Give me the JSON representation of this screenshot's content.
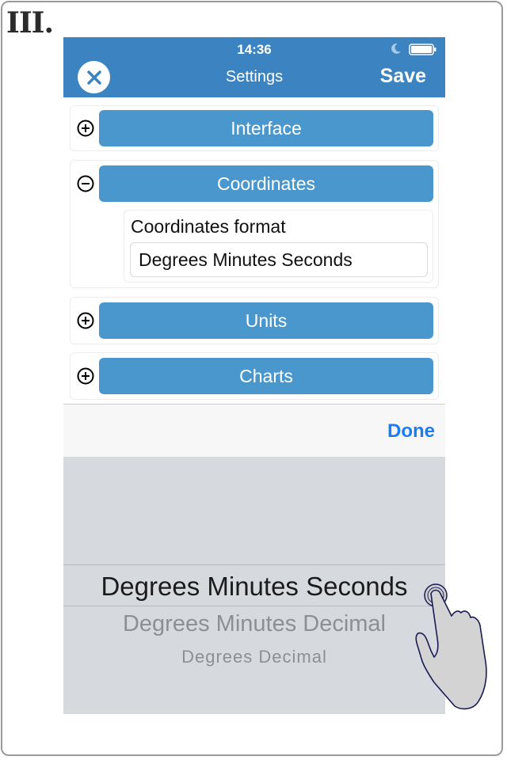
{
  "step_label": "III.",
  "status_bar": {
    "time": "14:36",
    "icons": [
      "moon-icon",
      "battery-icon"
    ]
  },
  "navbar": {
    "close_icon": "close-icon",
    "title": "Settings",
    "save_label": "Save"
  },
  "sections": [
    {
      "label": "Interface",
      "expanded": false,
      "icon": "plus-circle-icon"
    },
    {
      "label": "Coordinates",
      "expanded": true,
      "icon": "minus-circle-icon",
      "field": {
        "label": "Coordinates format",
        "value": "Degrees Minutes Seconds"
      }
    },
    {
      "label": "Units",
      "expanded": false,
      "icon": "plus-circle-icon"
    },
    {
      "label": "Charts",
      "expanded": false,
      "icon": "plus-circle-icon"
    }
  ],
  "picker": {
    "done_label": "Done",
    "selected": "Degrees Minutes Seconds",
    "options": [
      "Degrees Minutes Seconds",
      "Degrees Minutes Decimal",
      "Degrees Decimal"
    ]
  },
  "colors": {
    "navbar": "#3b84c1",
    "section_button": "#4a97cd",
    "done": "#1a7ef0",
    "picker_bg": "#d6d9de"
  }
}
